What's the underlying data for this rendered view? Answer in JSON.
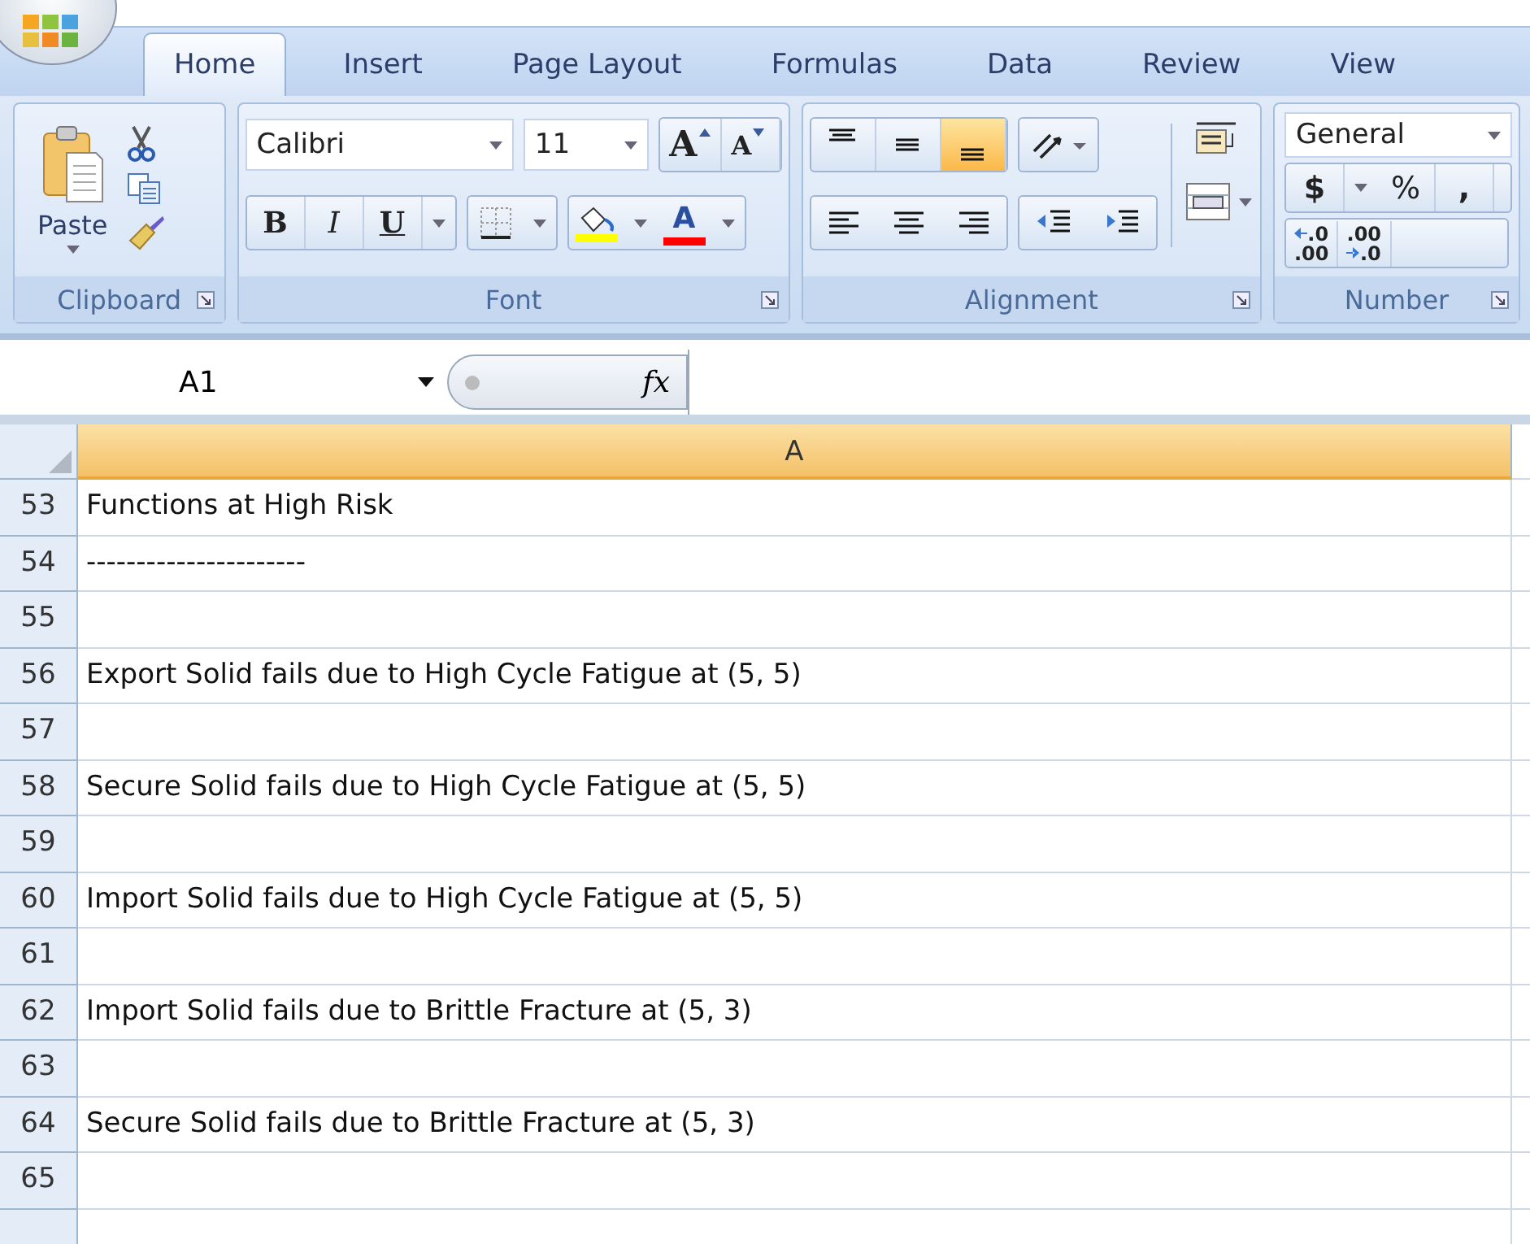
{
  "tabs": [
    {
      "label": "Home",
      "selected": true
    },
    {
      "label": "Insert",
      "selected": false
    },
    {
      "label": "Page Layout",
      "selected": false
    },
    {
      "label": "Formulas",
      "selected": false
    },
    {
      "label": "Data",
      "selected": false
    },
    {
      "label": "Review",
      "selected": false
    },
    {
      "label": "View",
      "selected": false
    }
  ],
  "clipboard": {
    "paste_label": "Paste",
    "group_label": "Clipboard"
  },
  "font": {
    "name": "Calibri",
    "size": "11",
    "grow": "A",
    "shrink": "A",
    "bold": "B",
    "italic": "I",
    "underline": "U",
    "color_letter": "A",
    "group_label": "Font"
  },
  "alignment": {
    "vertical": [
      {
        "kind": "top",
        "selected": false
      },
      {
        "kind": "middle",
        "selected": false
      },
      {
        "kind": "bottom",
        "selected": true
      }
    ],
    "group_label": "Alignment"
  },
  "number": {
    "format": "General",
    "currency": "$",
    "percent": "%",
    "comma": ",",
    "decimals": [
      {
        "kind": "increase",
        "top": ".0",
        "bottom": ".00"
      },
      {
        "kind": "decrease",
        "top": ".00",
        "bottom": ".0"
      }
    ],
    "group_label": "Number"
  },
  "formula_bar": {
    "name_box": "A1",
    "fx": "fx"
  },
  "sheet": {
    "columns": [
      {
        "label": "A",
        "selected": true
      }
    ],
    "rows": [
      {
        "number": "53",
        "cell": "Functions at High Risk"
      },
      {
        "number": "54",
        "cell": "----------------------"
      },
      {
        "number": "55"
      },
      {
        "number": "56",
        "cell": "Export Solid fails due to High Cycle Fatigue at (5, 5)"
      },
      {
        "number": "57"
      },
      {
        "number": "58",
        "cell": "Secure Solid fails due to High Cycle Fatigue at (5, 5)"
      },
      {
        "number": "59"
      },
      {
        "number": "60",
        "cell": "Import Solid fails due to High Cycle Fatigue at (5, 5)"
      },
      {
        "number": "61"
      },
      {
        "number": "62",
        "cell": "Import Solid fails due to Brittle Fracture at (5, 3)"
      },
      {
        "number": "63"
      },
      {
        "number": "64",
        "cell": "Secure Solid fails due to Brittle Fracture at (5, 3)"
      },
      {
        "number": "65"
      }
    ]
  }
}
